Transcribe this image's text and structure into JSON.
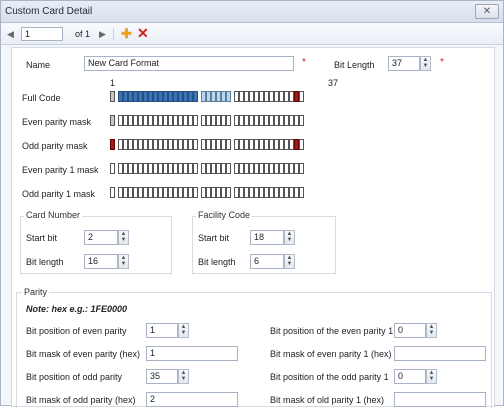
{
  "window": {
    "title": "Custom Card Detail",
    "close_glyph": "✕"
  },
  "toolbar": {
    "page": "1",
    "of_text": "of 1"
  },
  "form": {
    "name_label": "Name",
    "name_value": "New Card Format",
    "required_mark": "*",
    "bitlength_label": "Bit Length",
    "bitlength_value": "37",
    "range_start": "1",
    "range_end": "37"
  },
  "bitrows": [
    {
      "label": "Full Code"
    },
    {
      "label": "Even parity mask"
    },
    {
      "label": "Odd parity mask"
    },
    {
      "label": "Even parity 1 mask"
    },
    {
      "label": "Odd parity 1 mask"
    }
  ],
  "card_number": {
    "title": "Card Number",
    "start_label": "Start bit",
    "start_value": "2",
    "length_label": "Bit length",
    "length_value": "16"
  },
  "facility_code": {
    "title": "Facility Code",
    "start_label": "Start bit",
    "start_value": "18",
    "length_label": "Bit length",
    "length_value": "6"
  },
  "parity": {
    "title": "Parity",
    "note": "Note: hex e.g.: 1FE0000",
    "even_pos_label": "Bit position of even parity",
    "even_pos_value": "1",
    "even_mask_label": "Bit mask of even parity (hex)",
    "even_mask_value": "1",
    "odd_pos_label": "Bit position of odd parity",
    "odd_pos_value": "35",
    "odd_mask_label": "Bit mask of odd parity (hex)",
    "odd_mask_value": "2",
    "even1_pos_label": "Bit position of the even parity 1",
    "even1_pos_value": "0",
    "even1_mask_label": "Bit mask of even parity 1 (hex)",
    "even1_mask_value": "",
    "odd1_pos_label": "Bit position of the odd parity 1",
    "odd1_pos_value": "0",
    "odd1_mask_label": "Bit mask of old parity 1 (hex)",
    "odd1_mask_value": ""
  }
}
